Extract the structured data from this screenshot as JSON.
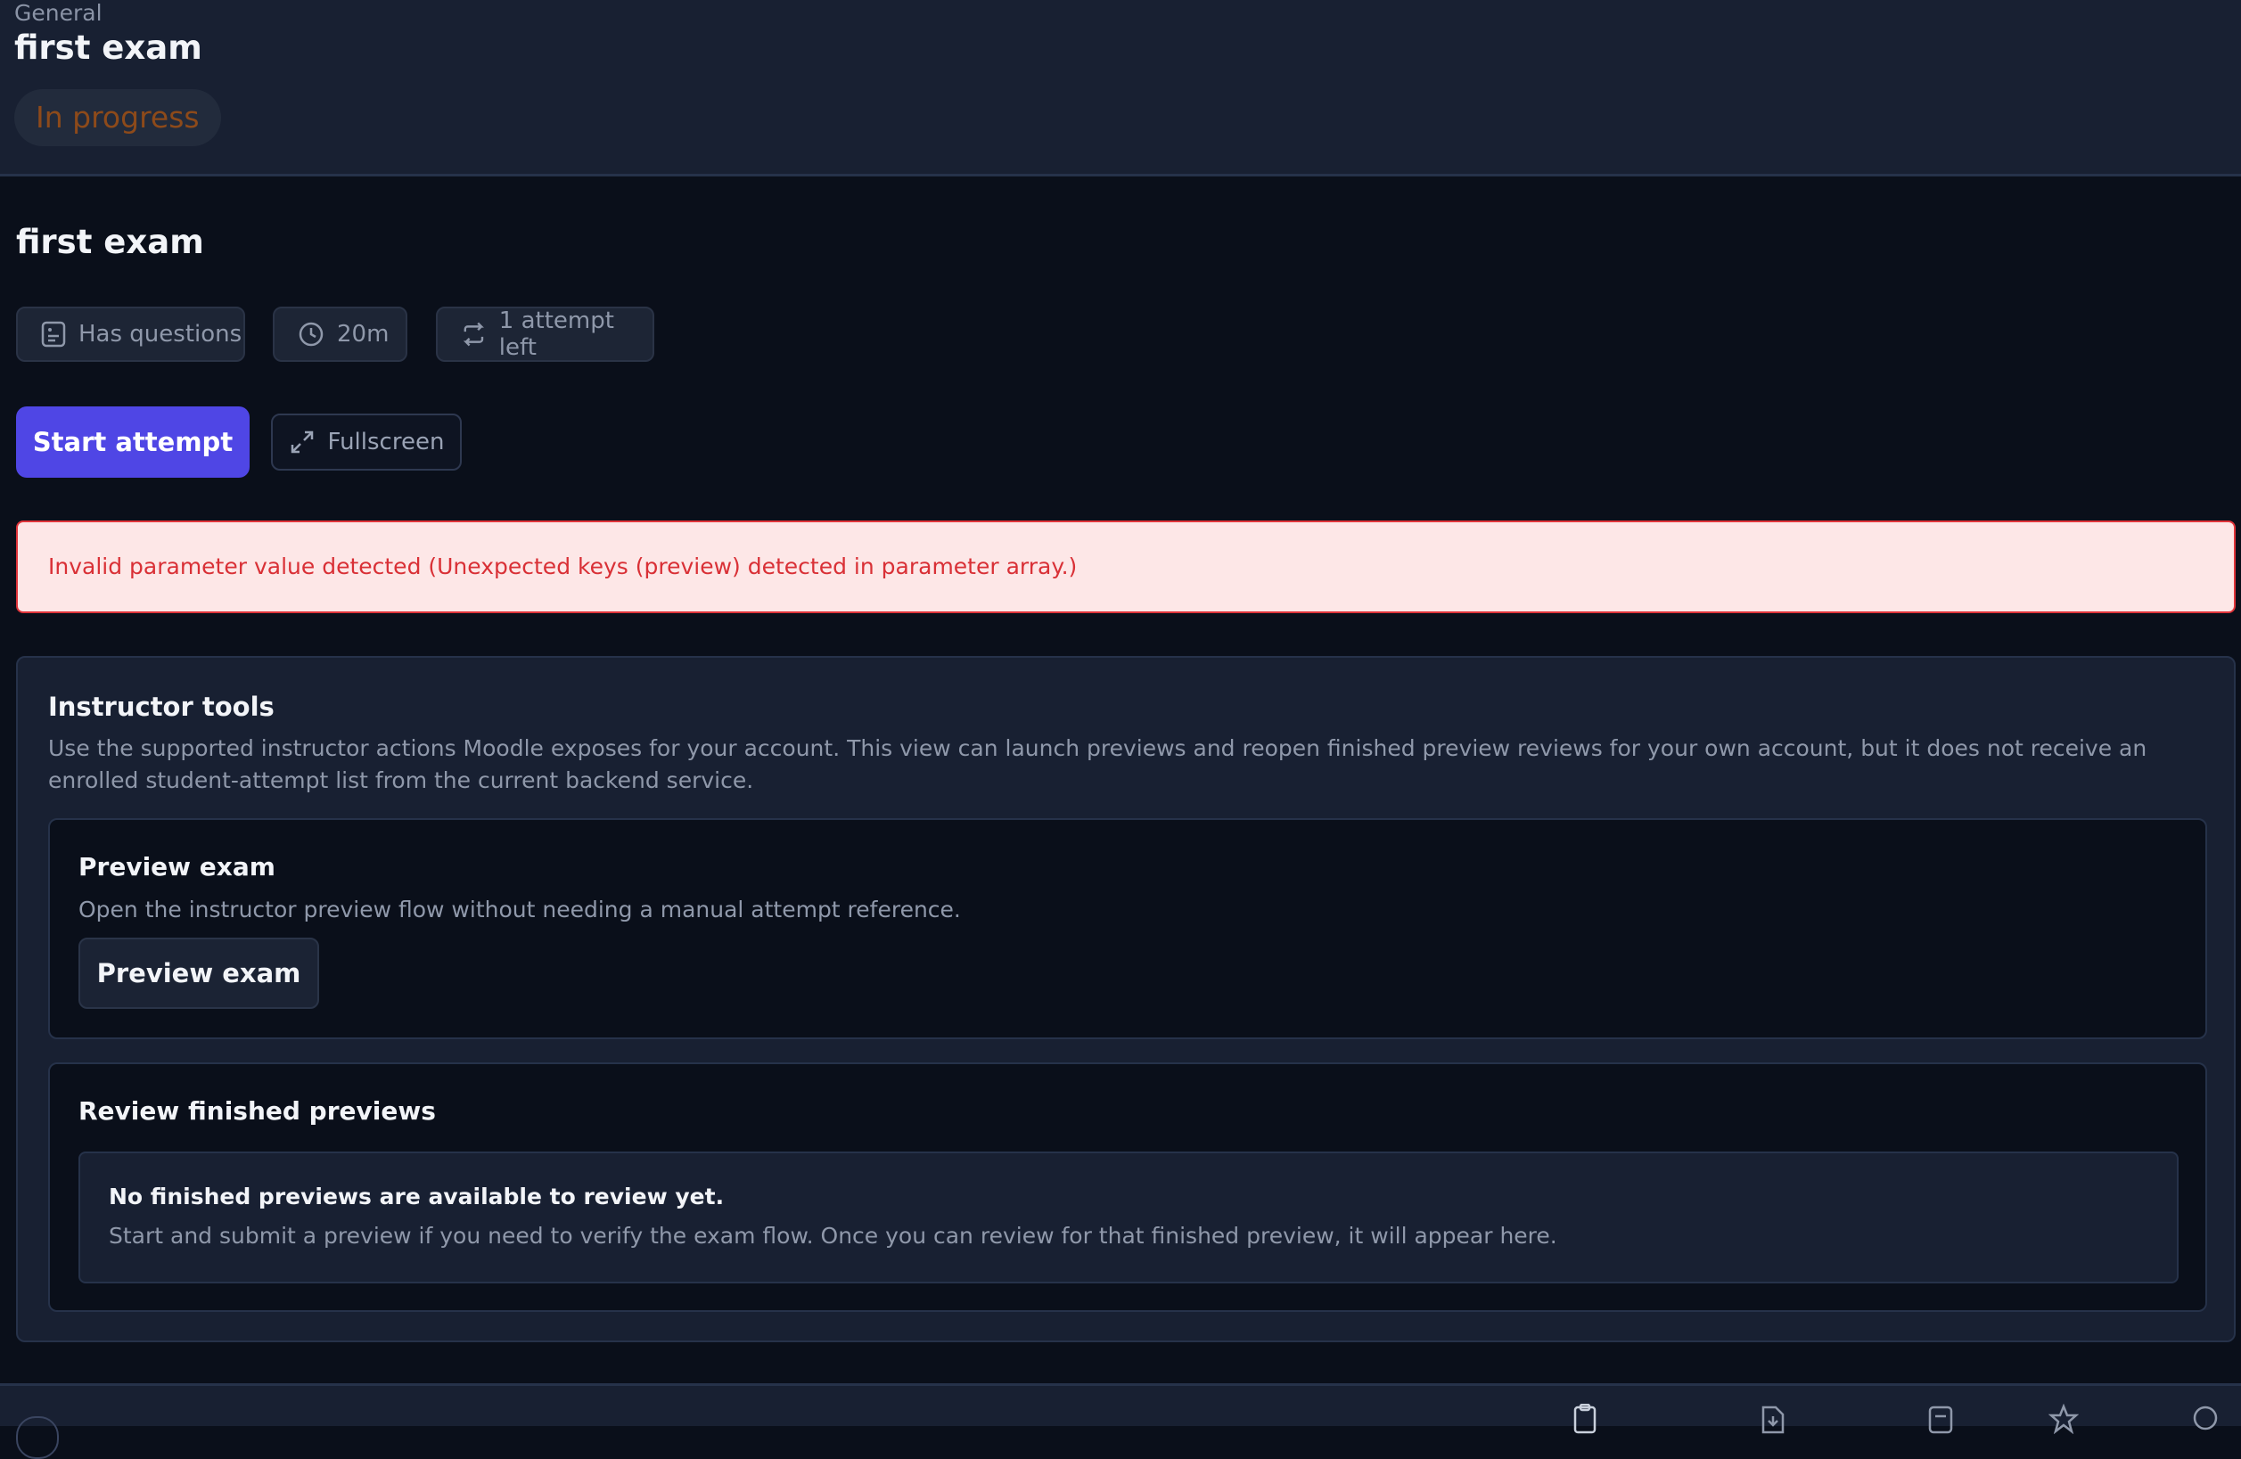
{
  "header": {
    "breadcrumb": "General",
    "title": "first exam",
    "status": "In progress"
  },
  "main": {
    "title": "first exam",
    "chips": {
      "questions": "Has questions",
      "duration": "20m",
      "attempts": "1 attempt left"
    },
    "start_label": "Start attempt",
    "fullscreen_label": "Fullscreen",
    "error": "Invalid parameter value detected (Unexpected keys (preview) detected in parameter array.)"
  },
  "instructor": {
    "title": "Instructor tools",
    "description": "Use the supported instructor actions Moodle exposes for your account. This view can launch previews and reopen finished preview reviews for your own account, but it does not receive an enrolled student-attempt list from the current backend service.",
    "preview": {
      "title": "Preview exam",
      "description": "Open the instructor preview flow without needing a manual attempt reference.",
      "button": "Preview exam"
    },
    "review": {
      "title": "Review finished previews",
      "empty_title": "No finished previews are available to review yet.",
      "empty_desc": "Start and submit a preview if you need to verify the exam flow. Once you can review for that finished preview, it will appear here."
    }
  },
  "icons": {
    "chip_questions": "document-icon",
    "chip_duration": "clock-icon",
    "chip_attempts": "repeat-icon",
    "fullscreen": "expand-icon",
    "nav": [
      "clipboard-icon",
      "download-file-icon",
      "notes-icon",
      "star-icon",
      "chat-icon"
    ]
  },
  "colors": {
    "accent": "#4f46e5",
    "status_text": "#8d4a1a",
    "error_text": "#d93036",
    "error_bg": "#fde7e7"
  }
}
